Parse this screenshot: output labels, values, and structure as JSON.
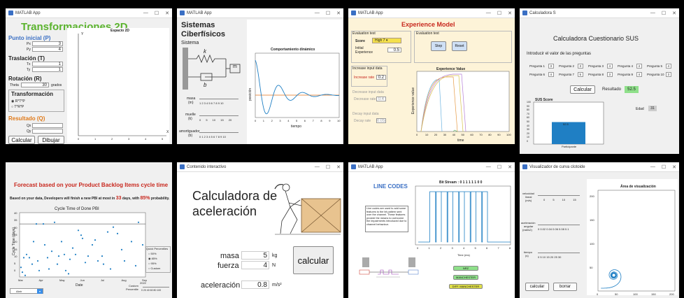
{
  "window_title": "MATLAB App",
  "p1": {
    "title": "Transformaciones 2D",
    "punto": "Punto inicial (P)",
    "px": "Px",
    "py": "Py",
    "px_val": "3",
    "py_val": "4",
    "traslacion": "Traslación (T)",
    "tx": "Tx",
    "ty": "Ty",
    "tx_val": "1",
    "ty_val": "1",
    "rotacion": "Rotación (R)",
    "theta": "Theta",
    "theta_val": "30",
    "grados": "grados",
    "transf": "Transformación",
    "opt1": "R*T*P",
    "opt2": "T*R*P",
    "resultado": "Resultado (Q)",
    "qx": "Qx",
    "qy": "Qy",
    "calc": "Calcular",
    "dibujar": "Dibujar",
    "plot_title": "Espacio 2D",
    "yl": "Y",
    "xl": "X",
    "xticks": [
      "0",
      "1",
      "2",
      "3",
      "4",
      "5"
    ]
  },
  "p2": {
    "title1": "Sistemas",
    "title2": "Ciberfísicos",
    "sub": "Sistema",
    "k": "k",
    "m": "m",
    "b": "b",
    "masa": "masa",
    "masa_u": "(m)",
    "masa_ticks": "1 2 3 4 5 6 7 8 9 10",
    "muelle": "muelle",
    "muelle_u": "(k)",
    "muelle_ticks": "0 5 10 15 20",
    "amort": "amortiguador",
    "amort_u": "(b)",
    "amort_ticks": "0 1 2 3 4 5 6 7 8 9 10",
    "plot_title": "Comportamiento dinámico",
    "ylabel": "posición",
    "xlabel": "tiempo",
    "xticks": [
      "0",
      "1",
      "2",
      "3",
      "4",
      "5",
      "6",
      "7",
      "8",
      "9",
      "10"
    ]
  },
  "p3": {
    "title": "Experience Model",
    "eval_test": "Evaluation test",
    "score": "Score",
    "score_val": "High 7",
    "initial": "Initial",
    "experience": "Experience",
    "exp_val": "0.5",
    "eval_text": "Evaluation test",
    "step": "Step",
    "reset": "Reset",
    "increase_data": "Increase input data",
    "inc_rate": "Increase rate",
    "inc_val": "0.2",
    "dec_data": "Decrease input data",
    "dec_rate": "Decrease rate",
    "dec_val": "0.4",
    "decay_data": "Decay input data",
    "decay_rate": "Decay rate",
    "decay_val": "0.05",
    "plot_title": "Experience Value",
    "ylabel": "Experience value",
    "xlabel": "time",
    "xticks": [
      "0",
      "10",
      "20",
      "30",
      "40",
      "50",
      "60",
      "70",
      "80",
      "90",
      "100"
    ]
  },
  "p4": {
    "win": "Calculadora S",
    "title": "Calculadora Cuestionario SUS",
    "prompt": "Introducir el valor de las preguntas",
    "q": [
      [
        "Pregunta 1",
        "3"
      ],
      [
        "Pregunta 2",
        "3"
      ],
      [
        "Pregunta 3",
        "4"
      ],
      [
        "Pregunta 4",
        "4"
      ],
      [
        "Pregunta 5",
        "4"
      ],
      [
        "Pregunta 6",
        "4"
      ],
      [
        "Pregunta 7",
        "5"
      ],
      [
        "Pregunta 8",
        "3"
      ],
      [
        "Pregunta 9",
        "4"
      ],
      [
        "Pregunta 10",
        "3"
      ]
    ],
    "calc": "Calcular",
    "res_lbl": "Resultado",
    "res_val": "52.5",
    "plot_title": "SUS Score",
    "bar_label": "52.5",
    "x_cat": "Participante",
    "edad": "Edad",
    "edad_val": "31"
  },
  "p5": {
    "title": "Forecast based on your Product Backlog Items cycle time",
    "sub_a": "Based on your data, Developers will finish a new PBI at most in",
    "days": "33",
    "sub_b": "days, with",
    "pct": "85%",
    "sub_c": "probability.",
    "plot_title": "Cycle Time of Done PBI",
    "ylabel": "Cycle Time (days)",
    "xlabel": "Date",
    "year": "2022",
    "xticks": [
      "Mar",
      "Apr",
      "May",
      "Jun",
      "Jul",
      "Aug",
      "Sep"
    ],
    "yticks": [
      "0",
      "5",
      "10",
      "15",
      "20",
      "25",
      "30",
      "35",
      "40"
    ],
    "qp": "Quick Percentiles",
    "opts": [
      "50%",
      "85%",
      "95%",
      "Custom"
    ],
    "custom": "Custom",
    "percentile": "Percentile",
    "ticks": "0 20 40 60 80 100",
    "view": "Abrir"
  },
  "p6": {
    "win": "Contenido interactivo",
    "title1": "Calculadora de",
    "title2": "aceleración",
    "masa": "masa",
    "masa_val": "5",
    "masa_u": "kg",
    "fuerza": "fuerza",
    "fuerza_val": "4",
    "fuerza_u": "N",
    "acel": "aceleración",
    "acel_val": "0.8",
    "acel_u": "m/s²",
    "calc": "calcular"
  },
  "p7": {
    "title": "LINE CODES",
    "plot_title": "Bit Stream : 0 1 1 1 1 1 0 0",
    "desc": "Line codes are used to add some features to the bit pattern sent over the channel. These features provide the means to overcome the impairments introduced due to channel behaviour.",
    "xlabel": "Time (ms)",
    "xticks": [
      "0",
      "1",
      "2",
      "3",
      "4",
      "5",
      "6",
      "7",
      "8"
    ],
    "nrz": "NRZ",
    "man": "MANCHESTER",
    "diff": "DIFF. MANCHESTER"
  },
  "p8": {
    "win": "Visualizador de curva clotoide",
    "plot_title": "Área de visualización",
    "vel": "velocidad",
    "vel2": "lineal",
    "vel_u": "(m/s)",
    "vel_ticks": "0 5 10 15",
    "acel": "aceleración",
    "acel2": "angular",
    "acel_u": "(rad/s2)",
    "acel_ticks": "0 0.02 0.04 0.06 0.08 0.1",
    "tiempo": "tiempo",
    "tiempo_u": "(s)",
    "tiempo_ticks": "0 5 10 15 20 25 30",
    "calc": "calcular",
    "borrar": "borrar",
    "yticks": [
      "200",
      "150",
      "100",
      "50"
    ],
    "xticks": [
      "0",
      "50",
      "100",
      "150",
      "200"
    ]
  }
}
